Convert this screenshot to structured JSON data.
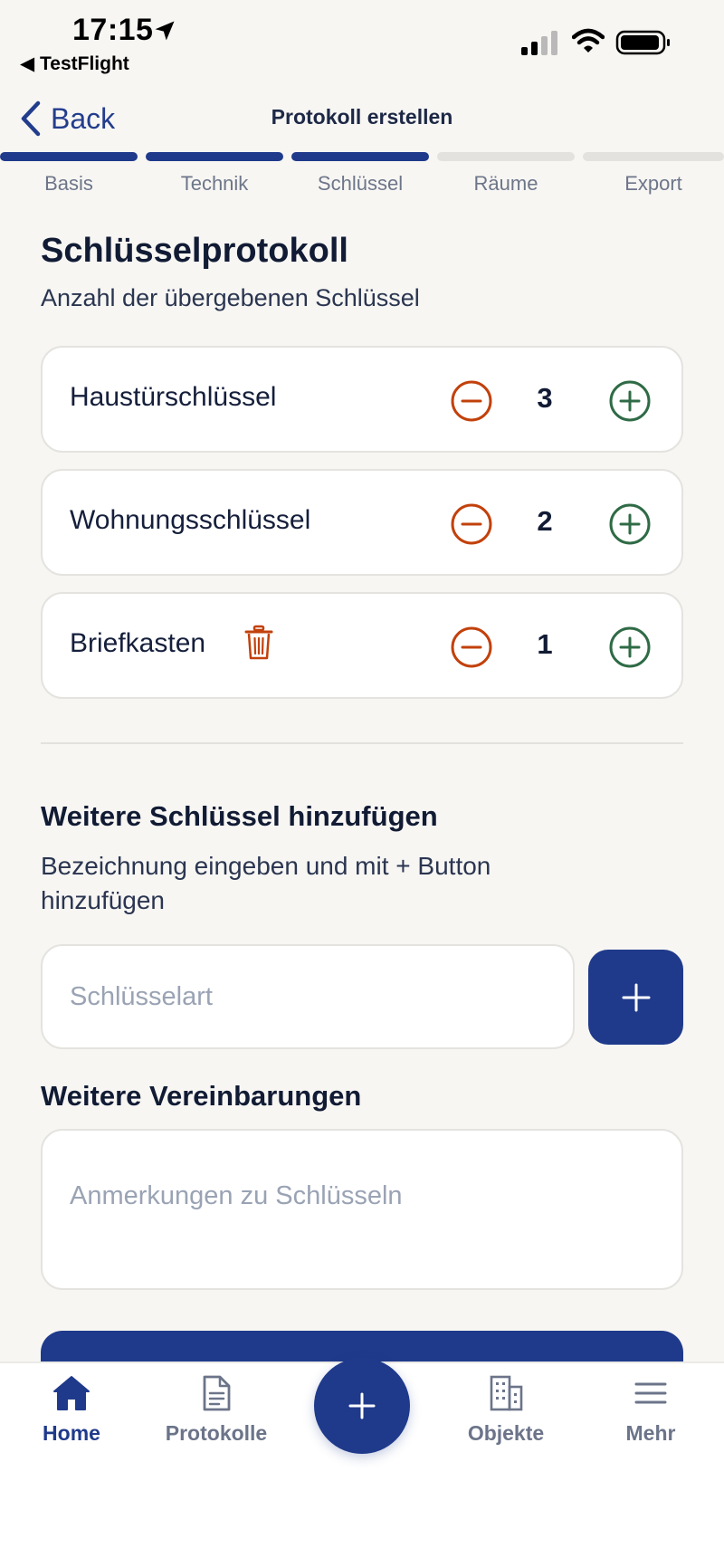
{
  "status_bar": {
    "time": "17:15",
    "return_app": "TestFlight"
  },
  "nav": {
    "back_label": "Back",
    "title": "Protokoll erstellen"
  },
  "steps": [
    {
      "label": "Basis",
      "done": true
    },
    {
      "label": "Technik",
      "done": true
    },
    {
      "label": "Schlüssel",
      "done": true
    },
    {
      "label": "Räume",
      "done": false
    },
    {
      "label": "Export",
      "done": false
    }
  ],
  "header": {
    "title": "Schlüsselprotokoll",
    "subtitle": "Anzahl der übergebenen Schlüssel"
  },
  "keys": [
    {
      "name": "Haustürschlüssel",
      "count": "3"
    },
    {
      "name": "Wohnungsschlüssel",
      "count": "2"
    },
    {
      "name": "Briefkasten",
      "count": "1"
    }
  ],
  "add_section": {
    "title": "Weitere Schlüssel hinzufügen",
    "help": "Bezeichnung eingeben und mit + Button hinzufügen",
    "input_placeholder": "Schlüsselart"
  },
  "agreements": {
    "title": "Weitere Vereinbarungen",
    "placeholder": "Anmerkungen zu Schlüsseln"
  },
  "tabbar": {
    "home": "Home",
    "protocols": "Protokolle",
    "objects": "Objekte",
    "more": "Mehr"
  },
  "colors": {
    "primary": "#1f3a8b",
    "minus": "#c2410c",
    "plus": "#2f6b46",
    "background": "#f7f6f3"
  }
}
